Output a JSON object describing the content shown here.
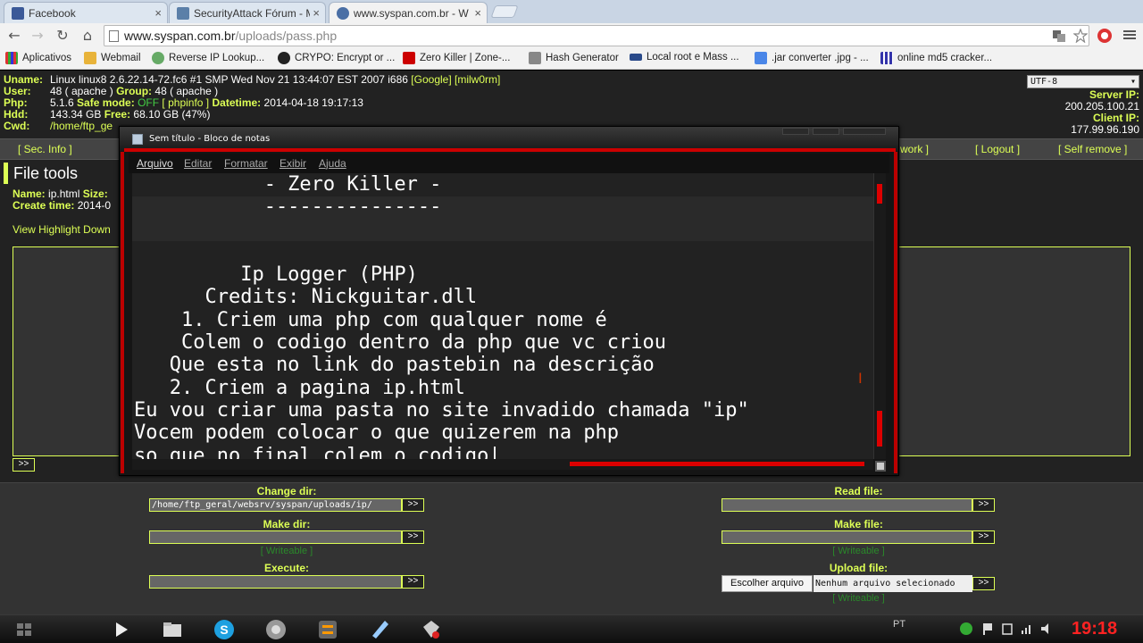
{
  "tabs": [
    {
      "title": "Facebook",
      "favicon_color": "#3b5998"
    },
    {
      "title": "SecurityAttack Fórum - Mc",
      "favicon_color": "#5b7fa8"
    },
    {
      "title": "www.syspan.com.br - W",
      "favicon_color": "#4a6fa5"
    }
  ],
  "address": {
    "host": "www.syspan.com.br",
    "path": "/uploads/pass.php"
  },
  "bookmarks": [
    {
      "label": "Aplicativos",
      "icon": "apps-grid-icon"
    },
    {
      "label": "Webmail",
      "icon": "webmail-icon"
    },
    {
      "label": "Reverse IP Lookup...",
      "icon": "reverse-ip-icon"
    },
    {
      "label": "CRYPO: Encrypt or ...",
      "icon": "crypo-icon"
    },
    {
      "label": "Zero Killer | Zone-...",
      "icon": "zone-h-icon"
    },
    {
      "label": "Hash Generator",
      "icon": "hash-icon"
    },
    {
      "label": "Local root e Mass ...",
      "icon": "local-root-icon"
    },
    {
      "label": ".jar converter .jpg - ...",
      "icon": "google-icon"
    },
    {
      "label": "online md5 cracker...",
      "icon": "md5-icon"
    }
  ],
  "server": {
    "uname_label": "Uname:",
    "uname": "Linux linux8 2.6.22.14-72.fc6 #1 SMP Wed Nov 21 13:44:07 EST 2007 i686",
    "google_link": "[Google]",
    "milw0rm_link": "[milw0rm]",
    "user_label": "User:",
    "user": "48 ( apache )",
    "group_label": "Group:",
    "group": "48 ( apache )",
    "php_label": "Php:",
    "php": "5.1.6",
    "safe_mode_label": "Safe mode:",
    "safe_mode": "OFF",
    "phpinfo_link": "[ phpinfo ]",
    "datetime_label": "Datetime:",
    "datetime": "2014-04-18 19:17:13",
    "hdd_label": "Hdd:",
    "hdd": "143.34 GB",
    "free_label": "Free:",
    "free": "68.10 GB (47%)",
    "cwd_label": "Cwd:",
    "cwd": "/home/ftp_ge",
    "encoding": "UTF-8",
    "server_ip_label": "Server IP:",
    "server_ip": "200.205.100.21",
    "client_ip_label": "Client IP:",
    "client_ip": "177.99.96.190"
  },
  "menu": {
    "sec_info": "[ Sec. Info ]",
    "network": "work ]",
    "logout": "[ Logout ]",
    "self_remove": "[ Self remove ]"
  },
  "file_tools": {
    "title": "File tools",
    "name_label": "Name:",
    "name": "ip.html",
    "size_label": "Size:",
    "create_label": "Create time:",
    "create": "2014-0",
    "view_links": "View Highlight Down",
    "go": ">>"
  },
  "forms": {
    "change_dir": {
      "label": "Change dir:",
      "value": "/home/ftp_geral/websrv/syspan/uploads/ip/"
    },
    "make_dir": {
      "label": "Make dir:",
      "writeable": "[ Writeable ]"
    },
    "execute": {
      "label": "Execute:"
    },
    "read_file": {
      "label": "Read file:"
    },
    "make_file": {
      "label": "Make file:",
      "writeable": "[ Writeable ]"
    },
    "upload_file": {
      "label": "Upload file:",
      "button": "Escolher arquivo",
      "status": "Nenhum arquivo selecionado",
      "writeable": "[ Writeable ]"
    },
    "go": ">>"
  },
  "notepad": {
    "title": "Sem título - Bloco de notas",
    "menu": [
      "Arquivo",
      "Editar",
      "Formatar",
      "Exibir",
      "Ajuda"
    ],
    "lines": [
      "           - Zero Killer -",
      "           ---------------",
      "",
      "",
      "         Ip Logger (PHP)",
      "      Credits: Nickguitar.dll",
      "    1. Criem uma php com qualquer nome é",
      "    Colem o codigo dentro da php que vc criou",
      "   Que esta no link do pastebin na descrição",
      "   2. Criem a pagina ip.html",
      "Eu vou criar uma pasta no site invadido chamada \"ip\"",
      "Vocem podem colocar o que quizerem na php",
      "so que no final colem o codigo|"
    ]
  },
  "taskbar": {
    "apps": [
      "windows-start-icon",
      "media-player-icon",
      "file-explorer-icon",
      "skype-icon",
      "chrome-icon",
      "sublime-text-icon",
      "notepad-icon",
      "network-tool-icon"
    ],
    "language": "PT",
    "clock": "19:18"
  }
}
